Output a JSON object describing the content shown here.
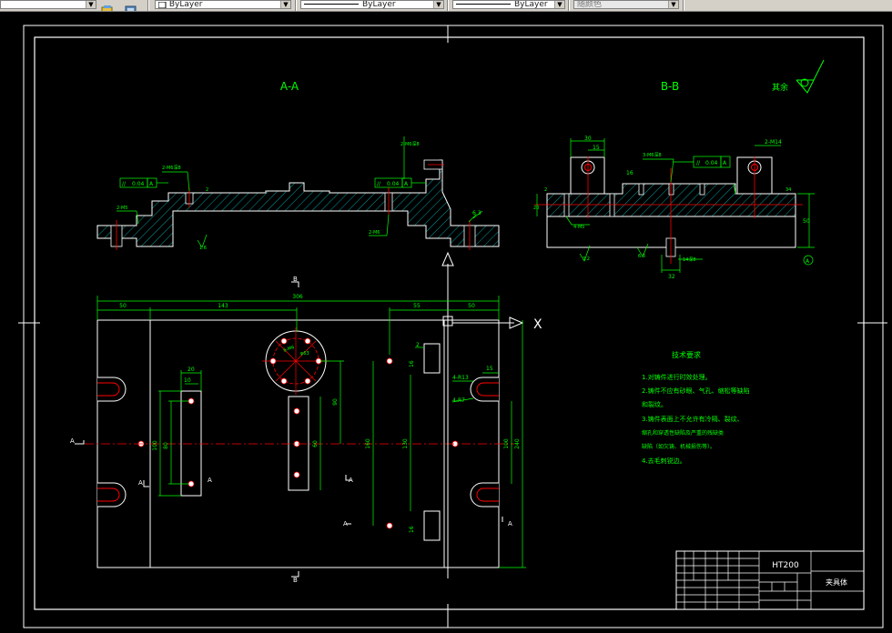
{
  "toolbar": {
    "layer_icon_1": "layer-states-icon",
    "layer_icon_2": "layer-previous-icon",
    "color_value": "ByLayer",
    "linetype_value": "ByLayer",
    "lineweight_value": "ByLayer",
    "plotstyle_value": "随颜色"
  },
  "colors": {
    "background": "#000000",
    "outline": "#ffffff",
    "dimension": "#00ff00",
    "centerline": "#ff0000",
    "section": "#00c8c8",
    "annotation": "#00ff00"
  },
  "drawing": {
    "section_aa_label": "A-A",
    "section_bb_label": "B-B",
    "roughness_other": "其余",
    "aa_tol_1": "//",
    "aa_tol_2": "0.04",
    "aa_tol_3": "A",
    "aa_hole_1": "2-M6深8",
    "aa_hole_2": "2-M5",
    "aa_hole_3": "2-M6",
    "aa_rough_1": "1.6",
    "aa_rough_2": "6.3",
    "aa_dim_2": "2",
    "bb_dim_30": "30",
    "bb_dim_15": "15",
    "bb_hole_1": "3-M6深8",
    "bb_hole_2": "2-M14",
    "bb_hole_3": "4-M5",
    "bb_tol_1": "//",
    "bb_tol_2": "0.04",
    "bb_tol_3": "A",
    "bb_dim_16": "16",
    "bb_dim_20": "20",
    "bb_dim_2": "2",
    "bb_dim_34": "34",
    "bb_dim_50": "50",
    "bb_dim_32": "32",
    "bb_dim_14": "14深8",
    "bb_rough_1": "3.2",
    "bb_rough_2": "6.3",
    "datum_a": "A",
    "plan_dim_306": "306",
    "plan_dim_50a": "50",
    "plan_dim_143": "143",
    "plan_dim_55": "55",
    "plan_dim_50b": "50",
    "plan_dim_20": "20",
    "plan_dim_10": "10",
    "plan_dim_100a": "100",
    "plan_dim_80": "80",
    "plan_dim_90": "90",
    "plan_dim_60": "60",
    "plan_dim_160": "160",
    "plan_dim_130": "130",
    "plan_dim_100b": "100",
    "plan_dim_240": "240",
    "plan_dim_15": "15",
    "plan_dim_2": "2",
    "plan_dim_16a": "16",
    "plan_dim_16b": "16",
    "plan_r13": "4-R13",
    "plan_r7": "4-R7",
    "plan_circle_label": "6-M6",
    "plan_circle_dim": "φ63",
    "section_mark_a": "A",
    "section_mark_b": "B",
    "axis_x": "X",
    "tech_title": "技术要求",
    "tech_1": "1.对铸件进行时效处理。",
    "tech_2": "2.铸件不应有砂眼、气孔、缩松等缺陷",
    "tech_2b": "和裂纹。",
    "tech_3": "3.铸件表面上不允许有冷隔、裂纹、",
    "tech_3b": "缩孔和穿透性缺陷及严重的残缺类",
    "tech_3c": "缺陷（如欠铸、机械损伤等）。",
    "tech_4": "4.去毛刺锐边。",
    "tb_material": "HT200",
    "tb_name": "夹具体"
  }
}
